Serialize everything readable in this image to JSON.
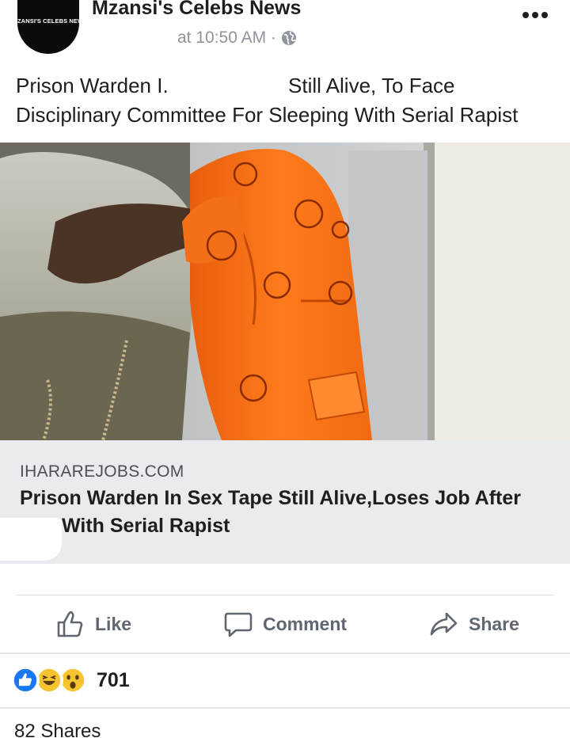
{
  "header": {
    "avatar_text": "ZANSI'S CELEBS NEW",
    "page_name": "Mzansi's Celebs News",
    "timestamp": "at 10:50 AM · ",
    "privacy_icon": "globe-icon",
    "more_icon": "more-options-icon"
  },
  "post": {
    "text_line1_left": "Prison Warden I.",
    "text_line1_right": "Still Alive, To Face",
    "text_line2": "Disciplinary Committee For Sleeping With Serial Rapist"
  },
  "link_preview": {
    "domain": "IHARAREJOBS.COM",
    "title_line1": "Prison Warden In Sex Tape Still Alive,Loses Job After",
    "title_line2": "With Serial Rapist"
  },
  "actions": {
    "like_label": "Like",
    "comment_label": "Comment",
    "share_label": "Share"
  },
  "reactions": {
    "icons": [
      "like-reaction-icon",
      "haha-reaction-icon",
      "wow-reaction-icon"
    ],
    "count": "701"
  },
  "shares": {
    "label": "82 Shares"
  },
  "colors": {
    "like_blue": "#1877f2",
    "emoji_yellow": "#f7c431",
    "caption_bg": "#e9ebee",
    "secondary_text": "#606770"
  }
}
